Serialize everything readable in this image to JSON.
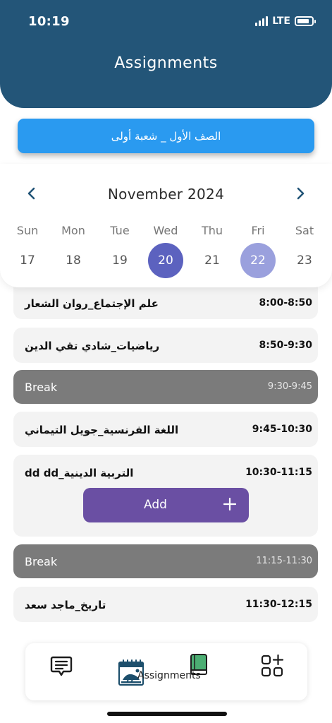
{
  "status_bar": {
    "time": "10:19",
    "network": "LTE",
    "battery_level": 0.7
  },
  "header": {
    "title": "Assignments"
  },
  "class_selector": {
    "label": "الصف الأول _ شعبة  أولى"
  },
  "calendar": {
    "month": "November 2024",
    "prev_icon": "chevron-left-icon",
    "next_icon": "chevron-right-icon",
    "days": [
      {
        "name": "Sun",
        "num": "17"
      },
      {
        "name": "Mon",
        "num": "18"
      },
      {
        "name": "Tue",
        "num": "19"
      },
      {
        "name": "Wed",
        "num": "20"
      },
      {
        "name": "Thu",
        "num": "21"
      },
      {
        "name": "Fri",
        "num": "22"
      },
      {
        "name": "Sat",
        "num": "23"
      }
    ],
    "selected_day": "20",
    "marked_day": "22",
    "colors": {
      "selected": "#5c62bf",
      "marked": "#9aa0dd"
    }
  },
  "schedule": [
    {
      "subject": "علم الإجتماع_روان الشعار",
      "time": "8:00-8:50",
      "type": "class"
    },
    {
      "subject": "رياضيات_شادي تقي الدين",
      "time": "8:50-9:30",
      "type": "class"
    },
    {
      "subject": "Break",
      "time": "9:30-9:45",
      "type": "break"
    },
    {
      "subject": "اللغة الفرنسية_جويل التيماني",
      "time": "9:45-10:30",
      "type": "class"
    },
    {
      "subject": "التربية الدينية_dd dd",
      "time": "10:30-11:15",
      "type": "class",
      "add_label": "Add"
    },
    {
      "subject": "Break",
      "time": "11:15-11:30",
      "type": "break"
    },
    {
      "subject": "تاريخ_ماجد سعد",
      "time": "11:30-12:15",
      "type": "class"
    }
  ],
  "tabbar": {
    "items": [
      {
        "icon": "message-icon"
      },
      {
        "icon": "calendar-icon"
      },
      {
        "icon": "book-icon",
        "label": "Assignments",
        "active": true
      },
      {
        "icon": "apps-add-icon"
      }
    ]
  },
  "colors": {
    "header": "#235578",
    "class_button": "#2a9af0",
    "add_button": "#6a4fa3",
    "break_row": "#7b7b7b",
    "row": "#f3f3f3"
  }
}
